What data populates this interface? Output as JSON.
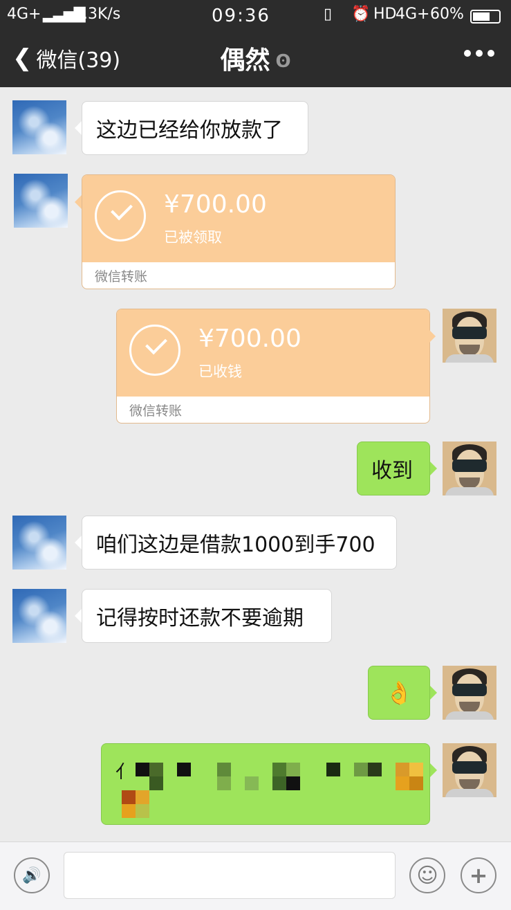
{
  "status_bar": {
    "network": "4G+",
    "speed": "4.3K/s",
    "time": "09:36",
    "hd": "HD",
    "network2": "4G+",
    "battery": "60%"
  },
  "nav": {
    "back_label": "微信(39)",
    "title": "偶然"
  },
  "messages": [
    {
      "side": "left",
      "type": "text",
      "text": "这边已经给你放款了"
    },
    {
      "side": "left",
      "type": "transfer",
      "amount": "¥700.00",
      "status": "已被领取",
      "footer": "微信转账"
    },
    {
      "side": "right",
      "type": "transfer",
      "amount": "¥700.00",
      "status": "已收钱",
      "footer": "微信转账"
    },
    {
      "side": "right",
      "type": "text",
      "text": "收到"
    },
    {
      "side": "left",
      "type": "text",
      "text": "咱们这边是借款1000到手700"
    },
    {
      "side": "left",
      "type": "text",
      "text": "记得按时还款不要逾期"
    },
    {
      "side": "right",
      "type": "emoji",
      "text": "👌"
    },
    {
      "side": "right",
      "type": "redacted",
      "text": "亻"
    }
  ],
  "colors": {
    "header": "#2c2c2c",
    "background": "#ebebeb",
    "bubble_green": "#9ee45b",
    "transfer_orange": "#fbcd99"
  }
}
